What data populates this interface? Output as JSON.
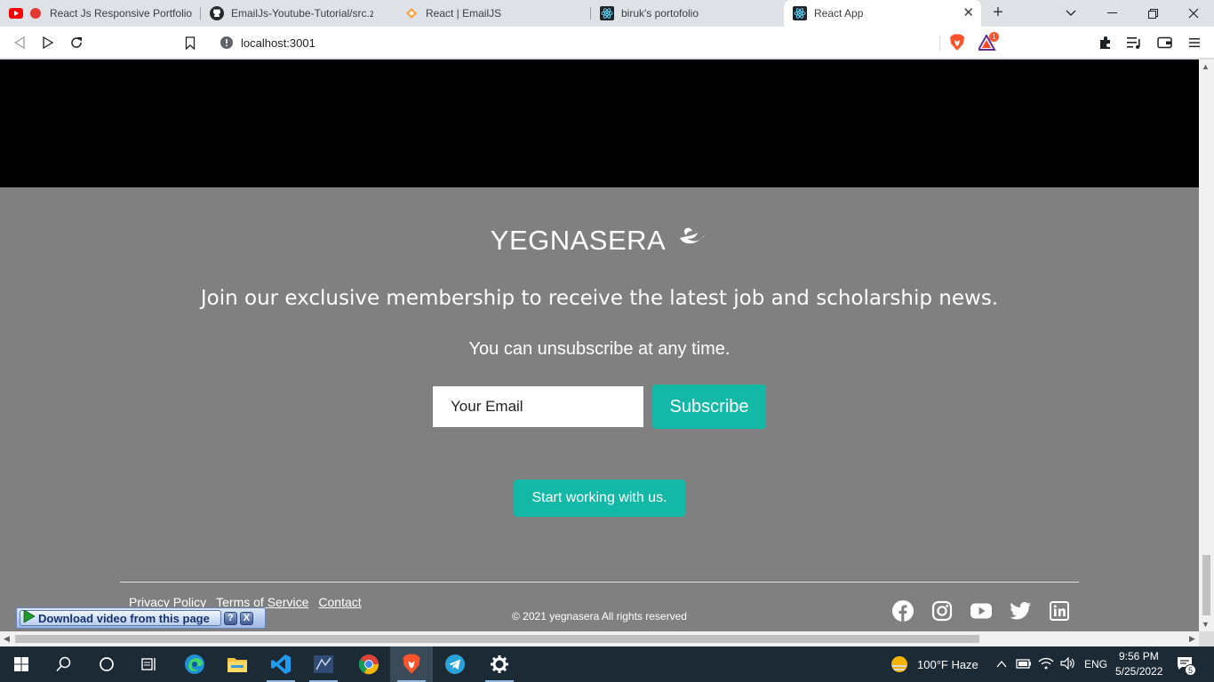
{
  "browser": {
    "tabs": [
      {
        "title": "React Js Responsive Portfolio w",
        "icon": "youtube-icon"
      },
      {
        "title": "EmailJs-Youtube-Tutorial/src.zip at",
        "icon": "github-icon"
      },
      {
        "title": "React | EmailJS",
        "icon": "emailjs-icon"
      },
      {
        "title": "biruk's portofolio",
        "icon": "react-icon"
      },
      {
        "title": "React App",
        "icon": "react-icon",
        "active": true
      }
    ],
    "url": "localhost:3001",
    "brave_badge": "1"
  },
  "page": {
    "logo_text": "YEGNASERA",
    "headline": "Join our exclusive membership to receive the latest job and scholarship news.",
    "subline": "You can unsubscribe at any time.",
    "email_placeholder": "Your Email",
    "subscribe_label": "Subscribe",
    "start_label": "Start working with us.",
    "footer_links": [
      "Privacy Policy",
      "Terms of Service",
      "Contact"
    ],
    "copyright": "© 2021 yegnasera All rights reserved",
    "socials": [
      "facebook-icon",
      "instagram-icon",
      "youtube-icon",
      "twitter-icon",
      "linkedin-icon"
    ],
    "accent_color": "#14b8a6",
    "background_color": "#808080"
  },
  "download_bar": {
    "label": "Download video from this page",
    "help": "?",
    "close": "X"
  },
  "taskbar": {
    "weather": "100°F  Haze",
    "lang": "ENG",
    "time": "9:56 PM",
    "date": "5/25/2022",
    "notifications": "5"
  }
}
